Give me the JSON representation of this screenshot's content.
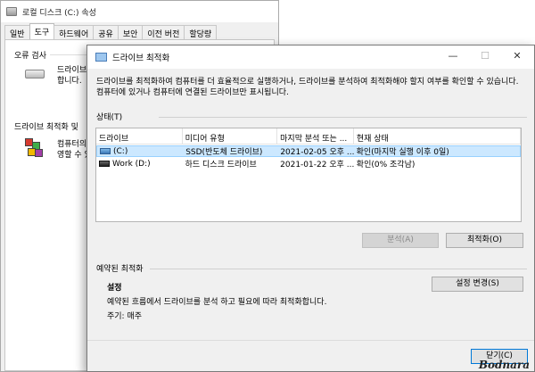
{
  "props": {
    "title": "로컬 디스크 (C:) 속성",
    "tabs": [
      "일반",
      "도구",
      "하드웨어",
      "공유",
      "보안",
      "이전 버전",
      "할당량"
    ],
    "error_check": {
      "title": "오류 검사",
      "desc1": "드라이브",
      "desc2": "합니다."
    },
    "optimize": {
      "title": "드라이브 최적화 및",
      "desc1": "컴퓨터의",
      "desc2": "영할 수 있"
    }
  },
  "optimize": {
    "title": "드라이브 최적화",
    "intro": "드라이브를 최적화하여 컴퓨터를 더 효율적으로 실행하거나, 드라이브를 분석하여 최적화해야 할지 여부를 확인할 수 있습니다. 컴퓨터에 있거나 컴퓨터에 연결된 드라이브만 표시됩니다.",
    "status_label": "상태(T)",
    "columns": [
      "드라이브",
      "미디어 유형",
      "마지막 분석 또는 ...",
      "현재 상태"
    ],
    "rows": [
      {
        "drive": "(C:)",
        "media": "SSD(반도체 드라이브)",
        "last": "2021-02-05 오후 ...",
        "status": "확인(마지막 실행 이후 0일)",
        "selected": true
      },
      {
        "drive": "Work (D:)",
        "media": "하드 디스크 드라이브",
        "last": "2021-01-22 오후 ...",
        "status": "확인(0% 조각남)",
        "selected": false
      }
    ],
    "analyze_button": "분석(A)",
    "optimize_button": "최적화(O)",
    "scheduled_label": "예약된 최적화",
    "setting_title": "설정",
    "setting_desc": "예약된 흐름에서 드라이브를 분석 하고 필요에 따라 최적화합니다.",
    "frequency": "주기: 매주",
    "change_settings_button": "설정 변경(S)",
    "close_button": "닫기(C)",
    "window_controls": {
      "minimize": "—",
      "maximize": "☐",
      "close": "✕"
    }
  },
  "watermark": "Bodnara"
}
